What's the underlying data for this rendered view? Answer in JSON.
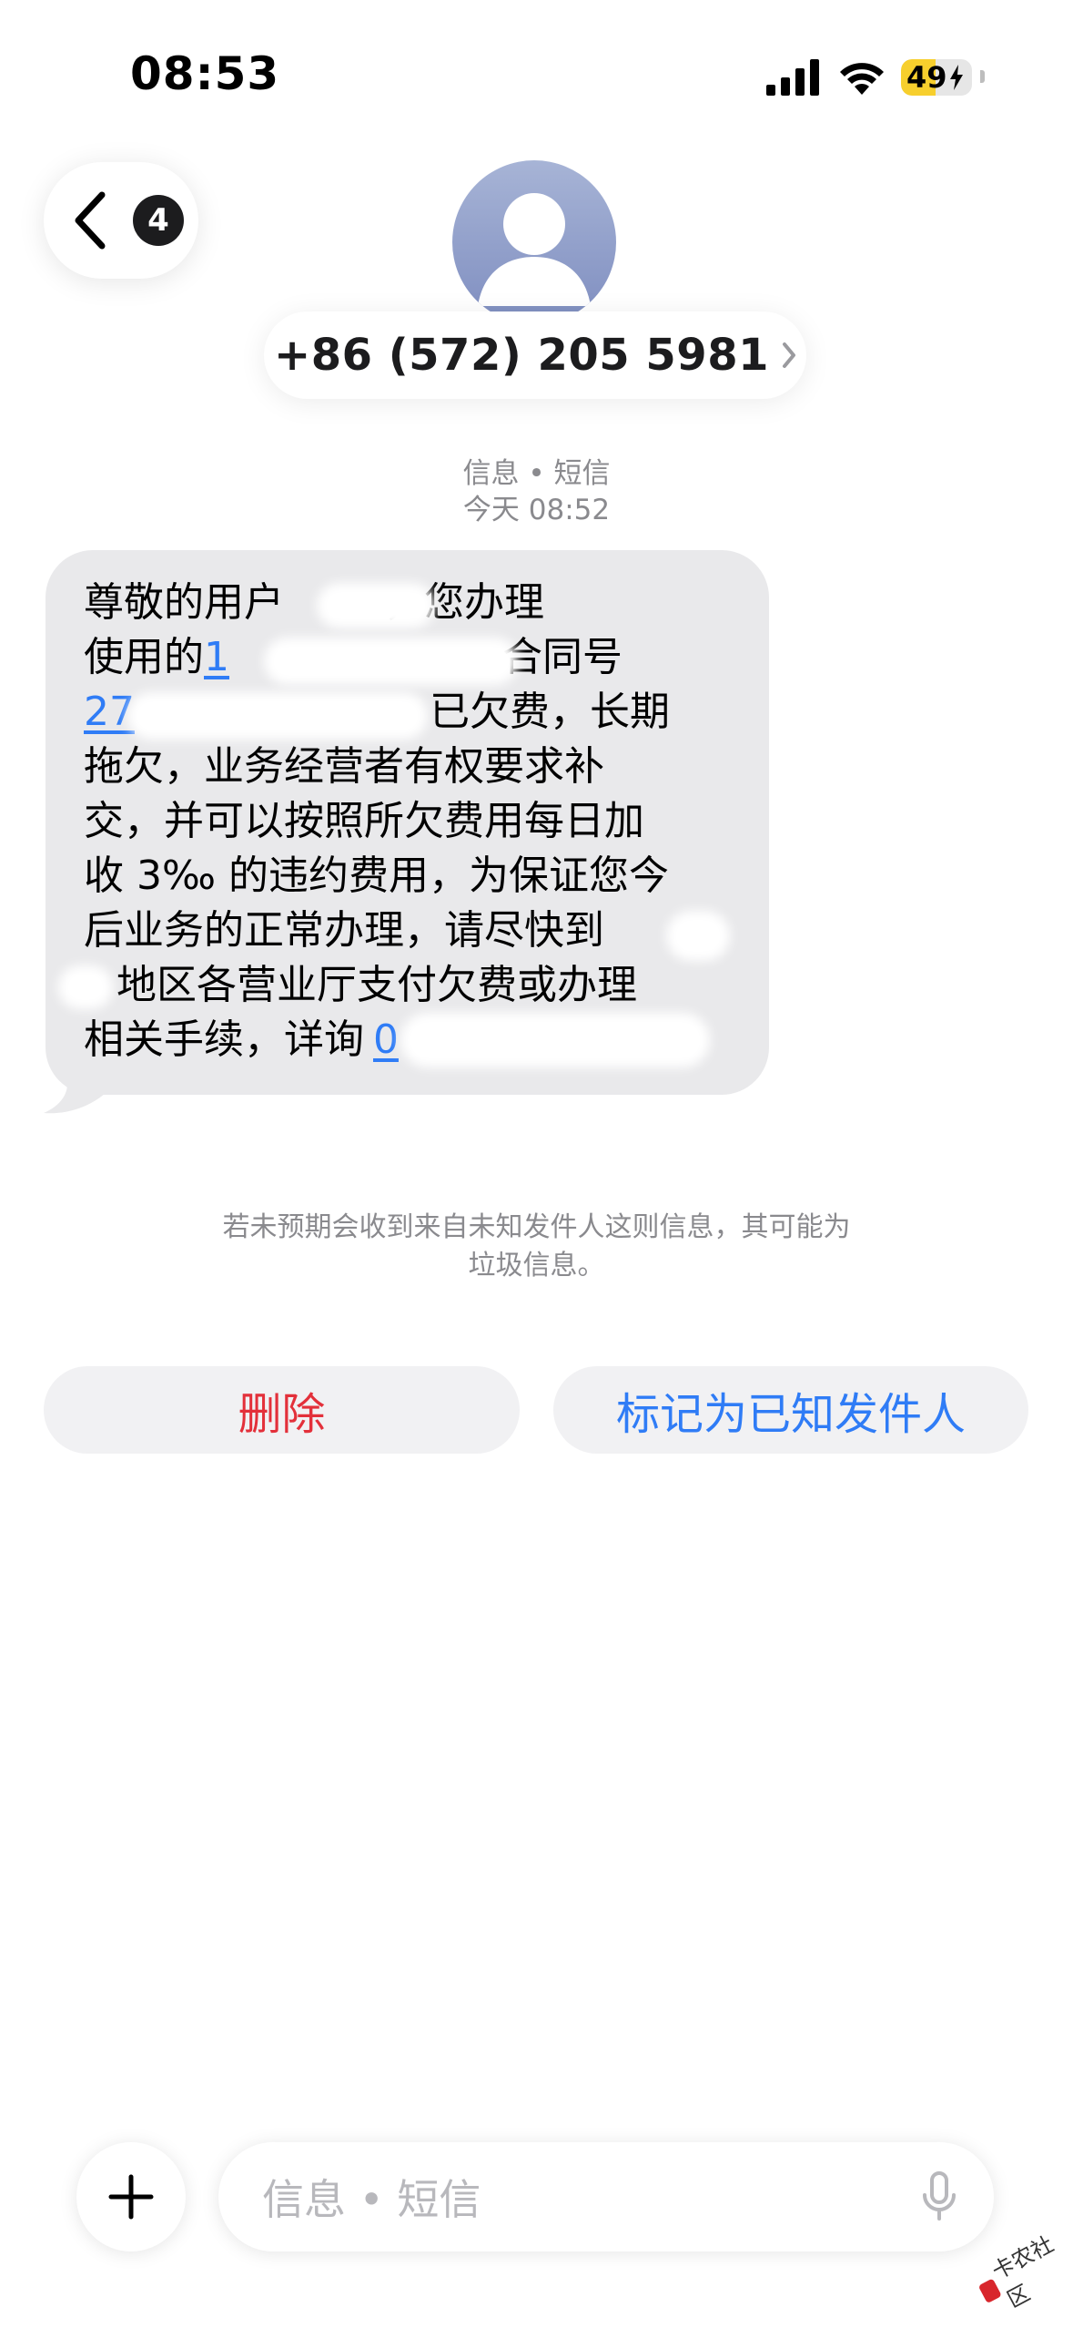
{
  "status_bar": {
    "time": "08:53",
    "battery_level": "49",
    "battery_fraction": 0.49,
    "icons": [
      "signal-icon",
      "wifi-icon",
      "battery-icon",
      "bolt-icon"
    ]
  },
  "header": {
    "back_badge_count": "4",
    "contact_number": "+86 (572) 205 5981",
    "icons": [
      "chevron-left-icon",
      "person-icon",
      "chevron-right-icon"
    ]
  },
  "conversation": {
    "service": "信息 • 短信",
    "timestamp": "今天 08:52"
  },
  "message": {
    "line1_a": "尊敬的用户",
    "line1_b": "，您办理",
    "line2_a": "使用的",
    "line2_link": "1",
    "line2_b": "合同号",
    "line3_link": "27",
    "line3_b": "已欠费，长期",
    "line4": "拖欠，业务经营者有权要求补",
    "line5": "交，并可以按照所欠费用每日加",
    "line6": "收 3‰ 的违约费用，为保证您今",
    "line7": "后业务的正常办理，请尽快到",
    "line8": "地区各营业厅支付欠费或办理",
    "line9_a": "相关手续，详询",
    "line9_link": "0"
  },
  "notice": {
    "line1": "若未预期会收到来自未知发件人这则信息，其可能为",
    "line2": "垃圾信息。"
  },
  "actions": {
    "delete_label": "删除",
    "mark_known_label": "标记为已知发件人",
    "delete_color": "#e3303a",
    "mark_known_color": "#2f7cf6"
  },
  "composer": {
    "placeholder": "信息 • 短信",
    "icons": [
      "plus-icon",
      "mic-icon"
    ]
  },
  "watermark": {
    "text": "卡农社区"
  }
}
